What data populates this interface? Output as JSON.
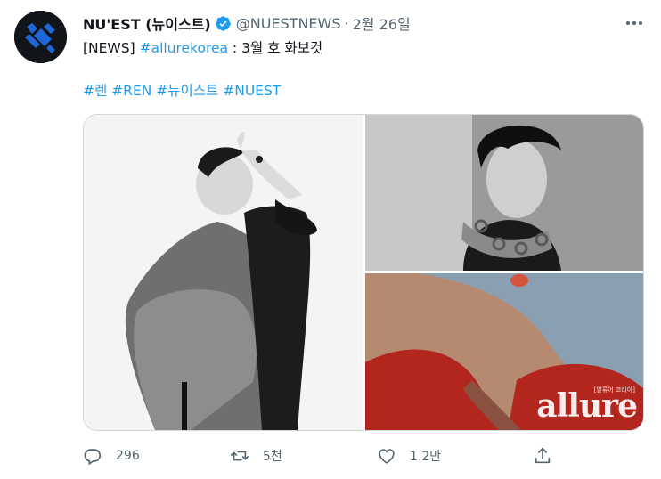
{
  "author": {
    "name": "NU'EST (뉴이스트)",
    "handle": "@NUESTNEWS",
    "separator": "·",
    "date": "2월 26일"
  },
  "tweet": {
    "line1_prefix": "[NEWS] ",
    "line1_link": "#allurekorea",
    "line1_suffix": " : 3월 호 화보컷",
    "hashtags": [
      "#렌",
      "#REN",
      "#뉴이스트",
      "#NUEST"
    ]
  },
  "media": {
    "watermark": "allure",
    "watermark_small": "[알류어 코리아]"
  },
  "actions": {
    "reply_count": "296",
    "retweet_count": "5천",
    "like_count": "1.2만"
  },
  "colors": {
    "link": "#1d9bf0",
    "muted": "#536471",
    "verified": "#1d9bf0",
    "avatar_bg": "#111418",
    "avatar_accent": "#1f66d6"
  }
}
